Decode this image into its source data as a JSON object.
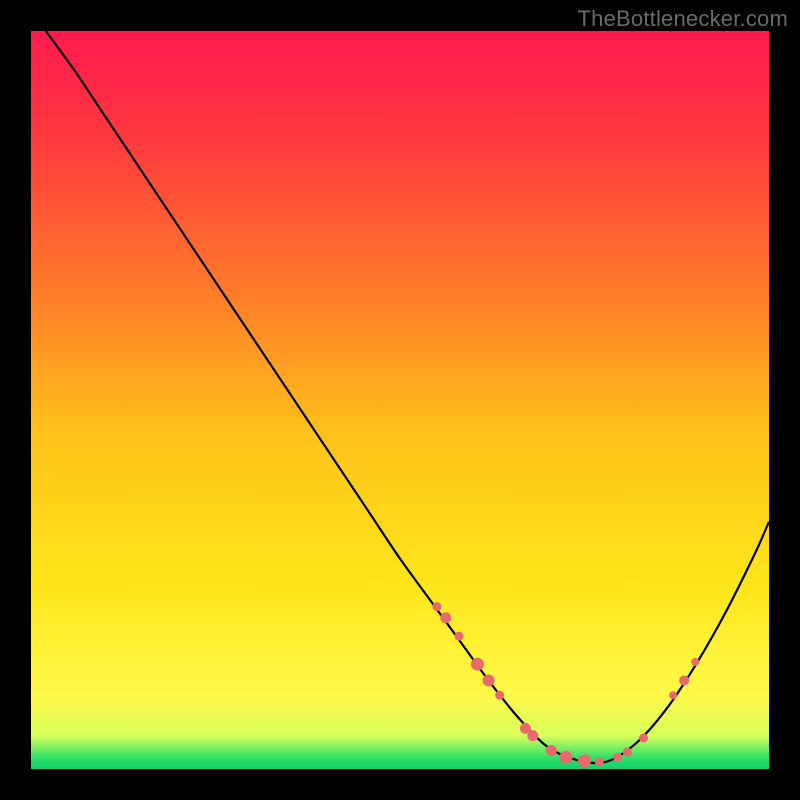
{
  "attribution": "TheBottlenecker.com",
  "colors": {
    "gradient_stops": [
      {
        "offset": 0.0,
        "color": "#ff1a4e"
      },
      {
        "offset": 0.15,
        "color": "#ff3a3e"
      },
      {
        "offset": 0.35,
        "color": "#ff7a2a"
      },
      {
        "offset": 0.55,
        "color": "#ffc31a"
      },
      {
        "offset": 0.75,
        "color": "#ffe61a"
      },
      {
        "offset": 0.9,
        "color": "#fff94a"
      },
      {
        "offset": 0.955,
        "color": "#d8ff5a"
      },
      {
        "offset": 0.985,
        "color": "#2fe06a"
      },
      {
        "offset": 1.0,
        "color": "#11d168"
      }
    ],
    "curve": "#000000",
    "marker_fill": "#e96a6a",
    "marker_stroke": "#e96a6a"
  },
  "chart_data": {
    "type": "line",
    "title": "",
    "xlabel": "",
    "ylabel": "",
    "xlim": [
      0,
      100
    ],
    "ylim": [
      0,
      100
    ],
    "series": [
      {
        "name": "bottleneck-curve",
        "x": [
          2,
          6,
          10,
          14,
          18,
          22,
          26,
          30,
          34,
          38,
          42,
          46,
          50,
          54,
          58,
          62,
          66,
          70,
          74,
          78,
          82,
          86,
          90,
          94,
          98,
          100
        ],
        "y": [
          100,
          94.5,
          88.5,
          82.5,
          76.5,
          70.5,
          64.5,
          58.5,
          52.5,
          46.5,
          40.5,
          34.5,
          28.5,
          23.0,
          17.5,
          12.0,
          7.0,
          3.0,
          1.2,
          1.0,
          3.5,
          8.0,
          14.0,
          21.0,
          29.0,
          33.5
        ]
      }
    ],
    "markers": [
      {
        "x": 55.0,
        "y": 22.0,
        "r": 4.0
      },
      {
        "x": 56.2,
        "y": 20.5,
        "r": 5.0
      },
      {
        "x": 58.0,
        "y": 18.0,
        "r": 4.0
      },
      {
        "x": 60.5,
        "y": 14.2,
        "r": 6.0
      },
      {
        "x": 62.0,
        "y": 12.0,
        "r": 5.5
      },
      {
        "x": 63.5,
        "y": 10.0,
        "r": 4.0
      },
      {
        "x": 67.0,
        "y": 5.5,
        "r": 5.0
      },
      {
        "x": 68.0,
        "y": 4.5,
        "r": 5.0
      },
      {
        "x": 70.5,
        "y": 2.5,
        "r": 5.0
      },
      {
        "x": 72.5,
        "y": 1.6,
        "r": 6.0
      },
      {
        "x": 75.0,
        "y": 1.1,
        "r": 6.0
      },
      {
        "x": 77.0,
        "y": 1.0,
        "r": 4.0
      },
      {
        "x": 79.5,
        "y": 1.6,
        "r": 4.0
      },
      {
        "x": 80.8,
        "y": 2.3,
        "r": 4.0
      },
      {
        "x": 83.0,
        "y": 4.2,
        "r": 4.0
      },
      {
        "x": 87.0,
        "y": 10.0,
        "r": 3.5
      },
      {
        "x": 88.5,
        "y": 12.0,
        "r": 4.5
      },
      {
        "x": 90.0,
        "y": 14.5,
        "r": 3.5
      }
    ]
  }
}
